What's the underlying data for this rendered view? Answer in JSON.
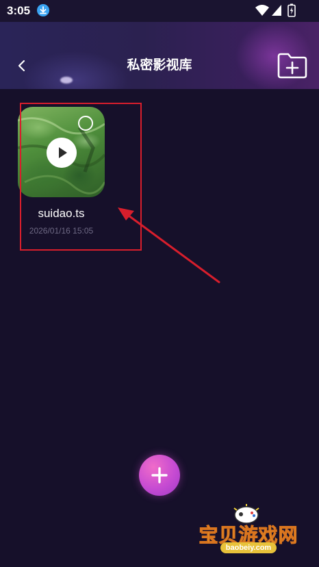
{
  "status_bar": {
    "time": "3:05",
    "icons": [
      "download-icon",
      "wifi-icon",
      "signal-icon",
      "battery-icon"
    ]
  },
  "header": {
    "title": "私密影视库",
    "back_icon": "back-chevron-icon",
    "action_icon": "new-folder-icon"
  },
  "videos": [
    {
      "name": "suidao.ts",
      "date": "2026/01/16 15:05",
      "thumbnail": "green-hills-landscape",
      "overlay_icon": "play-icon",
      "selection_icon": "select-circle-icon"
    }
  ],
  "fab": {
    "icon": "plus-icon"
  },
  "annotations": {
    "highlight_color": "#d81e2c",
    "arrow_color": "#d81e2c"
  },
  "watermark": {
    "text": "宝贝游戏网",
    "url": "baobeiy.com"
  },
  "colors": {
    "background": "#16102a",
    "accent": "#c64bd2"
  }
}
